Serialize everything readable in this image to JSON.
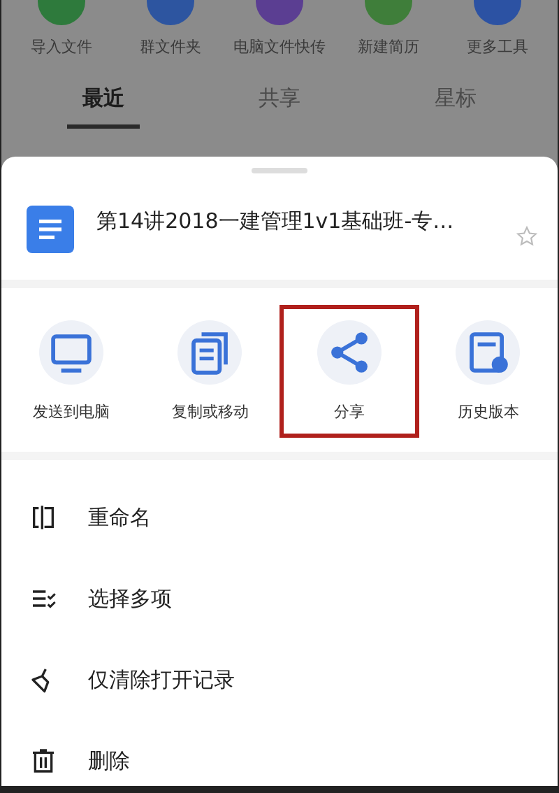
{
  "tools": [
    {
      "label": "导入文件",
      "color": "#2e7a3c"
    },
    {
      "label": "群文件夹",
      "color": "#2d55a0"
    },
    {
      "label": "电脑文件快传",
      "color": "#5b3e92"
    },
    {
      "label": "新建简历",
      "color": "#3f7e3a"
    },
    {
      "label": "更多工具",
      "color": "#2c52a3"
    }
  ],
  "tabs": [
    {
      "label": "最近",
      "selected": true
    },
    {
      "label": "共享",
      "selected": false
    },
    {
      "label": "星标",
      "selected": false
    }
  ],
  "file": {
    "title": "第14讲2018一建管理1v1基础班-专…",
    "starred": false
  },
  "actions": [
    {
      "kind": "monitor",
      "label": "发送到电脑",
      "highlighted": false
    },
    {
      "kind": "copy",
      "label": "复制或移动",
      "highlighted": false
    },
    {
      "kind": "share",
      "label": "分享",
      "highlighted": true
    },
    {
      "kind": "history",
      "label": "历史版本",
      "highlighted": false
    }
  ],
  "menu": [
    {
      "kind": "rename",
      "label": "重命名"
    },
    {
      "kind": "multiselect",
      "label": "选择多项"
    },
    {
      "kind": "clear",
      "label": "仅清除打开记录"
    },
    {
      "kind": "delete",
      "label": "删除"
    }
  ]
}
